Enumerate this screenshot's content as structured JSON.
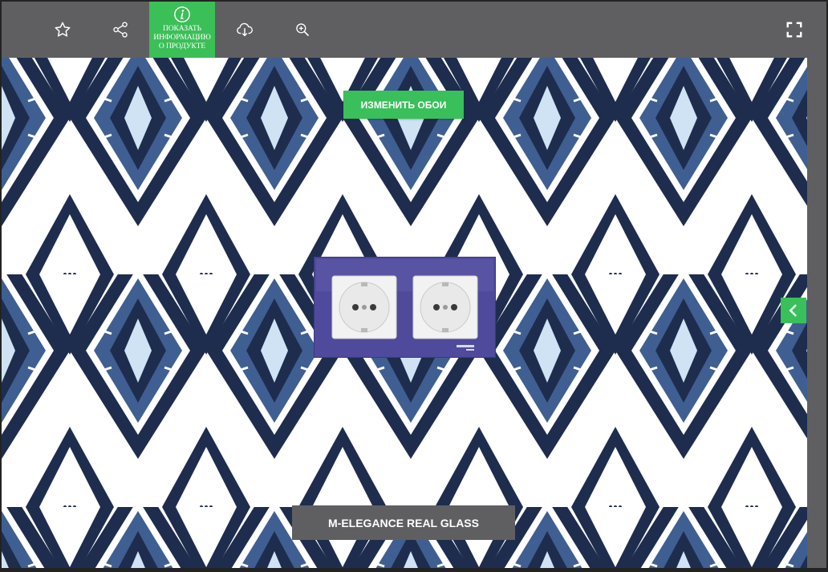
{
  "toolbar": {
    "favorite_icon": "star-icon",
    "share_icon": "share-icon",
    "info_icon": "info-icon",
    "info_label": "ПОКАЗАТЬ\nИНФОРМАЦИЮ\nО ПРОДУКТЕ",
    "download_icon": "cloud-download-icon",
    "zoom_icon": "zoom-icon",
    "fullscreen_icon": "fullscreen-icon"
  },
  "scene": {
    "change_wallpaper_label": "ИЗМЕНИТЬ ОБОИ",
    "product_name": "M-ELEGANCE REAL GLASS",
    "next_icon": "chevron-left-icon"
  },
  "colors": {
    "accent_green": "#39c05a",
    "toolbar_gray": "#5f5f61",
    "pattern_navy": "#1e2d4e",
    "pattern_blue": "#3f5f92",
    "frame_purple": "#4f4a9c"
  }
}
